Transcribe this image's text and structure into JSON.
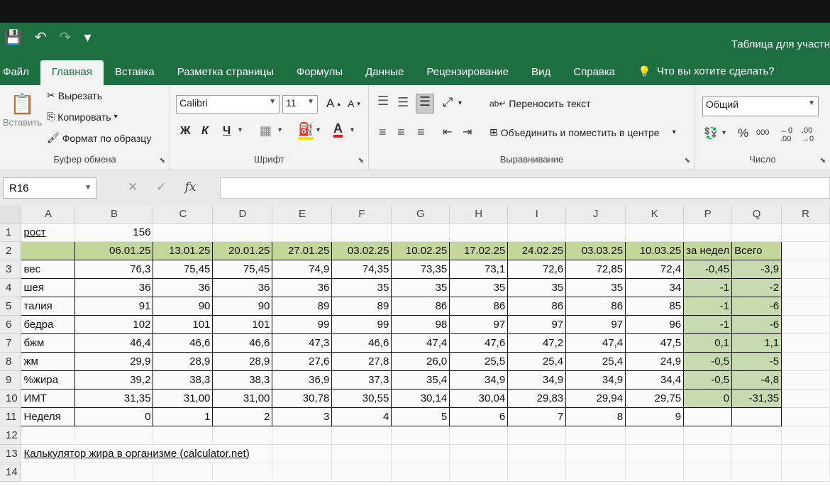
{
  "window": {
    "title": "Таблица для участн"
  },
  "qat": {
    "save": "💾",
    "undo": "↶",
    "redo": "↷",
    "customize": "▾"
  },
  "tabs": [
    "Файл",
    "Главная",
    "Вставка",
    "Разметка страницы",
    "Формулы",
    "Данные",
    "Рецензирование",
    "Вид",
    "Справка"
  ],
  "tell_me": {
    "icon": "lightbulb-icon",
    "label": "Что вы хотите сделать?"
  },
  "ribbon": {
    "clipboard": {
      "paste": "Вставить",
      "cut": "Вырезать",
      "copy": "Копировать",
      "format_painter": "Формат по образцу",
      "group": "Буфер обмена"
    },
    "font": {
      "name": "Calibri",
      "size": "11",
      "grow": "A",
      "shrink": "A",
      "bold": "Ж",
      "italic": "К",
      "underline": "Ч",
      "group": "Шрифт"
    },
    "alignment": {
      "wrap": "Переносить текст",
      "merge": "Объединить и поместить в центре",
      "group": "Выравнивание"
    },
    "number": {
      "format": "Общий",
      "percent": "%",
      "thousands": "000",
      "group": "Число"
    }
  },
  "formula_bar": {
    "name_box": "R16",
    "fx": "fx",
    "cancel": "✕",
    "enter": "✓",
    "value": ""
  },
  "columns": [
    "A",
    "B",
    "C",
    "D",
    "E",
    "F",
    "G",
    "H",
    "I",
    "J",
    "K",
    "P",
    "Q",
    "R"
  ],
  "rows": [
    {
      "n": "1",
      "label": "рост",
      "cells": [
        "156",
        "",
        "",
        "",
        "",
        "",
        "",
        "",
        "",
        "",
        "",
        ""
      ]
    },
    {
      "n": "2",
      "label": "",
      "cells": [
        "06.01.25",
        "13.01.25",
        "20.01.25",
        "27.01.25",
        "03.02.25",
        "10.02.25",
        "17.02.25",
        "24.02.25",
        "03.03.25",
        "10.03.25",
        "за недел",
        "Всего"
      ]
    },
    {
      "n": "3",
      "label": "вес",
      "cells": [
        "76,3",
        "75,45",
        "75,45",
        "74,9",
        "74,35",
        "73,35",
        "73,1",
        "72,6",
        "72,85",
        "72,4",
        "-0,45",
        "-3,9"
      ]
    },
    {
      "n": "4",
      "label": "шея",
      "cells": [
        "36",
        "36",
        "36",
        "36",
        "35",
        "35",
        "35",
        "35",
        "35",
        "34",
        "-1",
        "-2"
      ]
    },
    {
      "n": "5",
      "label": "талия",
      "cells": [
        "91",
        "90",
        "90",
        "89",
        "89",
        "86",
        "86",
        "86",
        "86",
        "85",
        "-1",
        "-6"
      ]
    },
    {
      "n": "6",
      "label": "бедра",
      "cells": [
        "102",
        "101",
        "101",
        "99",
        "99",
        "98",
        "97",
        "97",
        "97",
        "96",
        "-1",
        "-6"
      ]
    },
    {
      "n": "7",
      "label": "бжм",
      "cells": [
        "46,4",
        "46,6",
        "46,6",
        "47,3",
        "46,6",
        "47,4",
        "47,6",
        "47,2",
        "47,4",
        "47,5",
        "0,1",
        "1,1"
      ]
    },
    {
      "n": "8",
      "label": "жм",
      "cells": [
        "29,9",
        "28,9",
        "28,9",
        "27,6",
        "27,8",
        "26,0",
        "25,5",
        "25,4",
        "25,4",
        "24,9",
        "-0,5",
        "-5"
      ]
    },
    {
      "n": "9",
      "label": "%жира",
      "cells": [
        "39,2",
        "38,3",
        "38,3",
        "36,9",
        "37,3",
        "35,4",
        "34,9",
        "34,9",
        "34,9",
        "34,4",
        "-0,5",
        "-4,8"
      ]
    },
    {
      "n": "10",
      "label": "ИМТ",
      "cells": [
        "31,35",
        "31,00",
        "31,00",
        "30,78",
        "30,55",
        "30,14",
        "30,04",
        "29,83",
        "29,94",
        "29,75",
        "0",
        "-31,35"
      ]
    },
    {
      "n": "11",
      "label": "Неделя",
      "cells": [
        "0",
        "1",
        "2",
        "3",
        "4",
        "5",
        "6",
        "7",
        "8",
        "9",
        "",
        ""
      ]
    }
  ],
  "row12": {
    "n": "12"
  },
  "row13": {
    "n": "13",
    "link": "Калькулятор жира в организме (calculator.net)"
  },
  "row14": {
    "n": "14"
  }
}
